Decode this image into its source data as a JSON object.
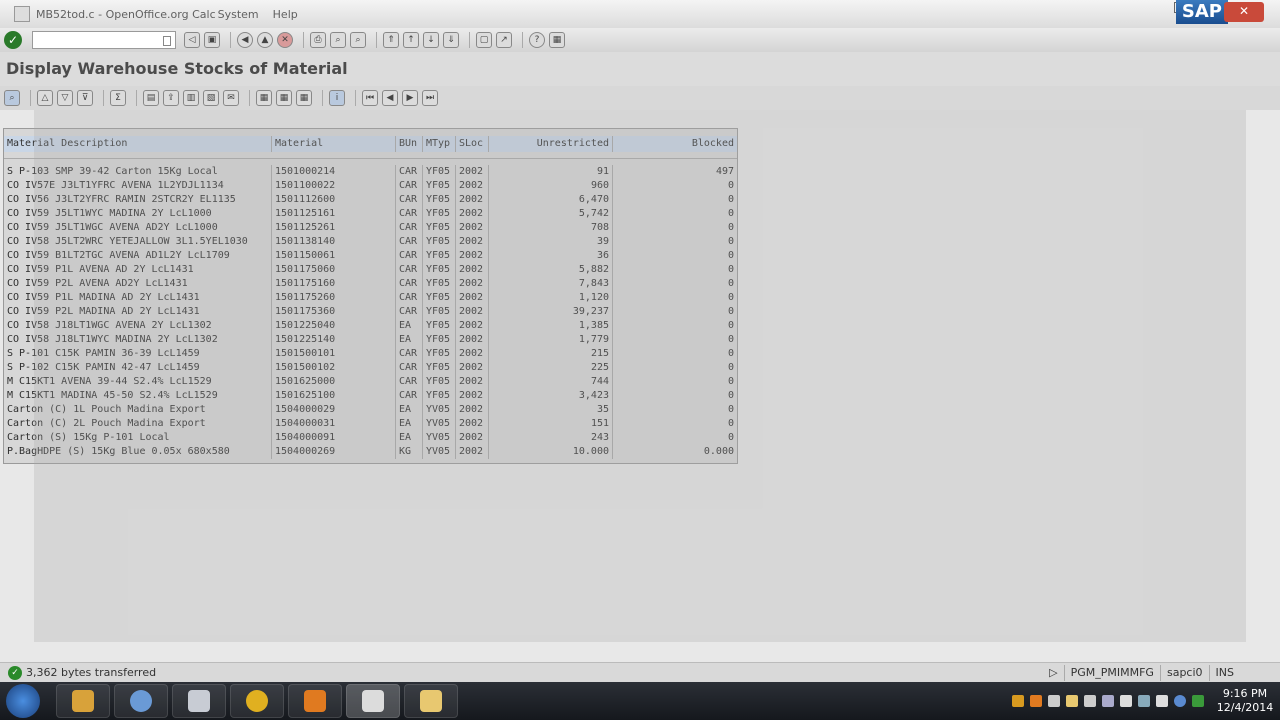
{
  "menubar": {
    "title_overlay": "MB52tod.c - OpenOffice.org Calc",
    "items": [
      "System",
      "Help"
    ]
  },
  "sap_logo": "SAP",
  "close_glyph": "✕",
  "screen": {
    "title": "Display Warehouse Stocks of Material"
  },
  "toolbar": {
    "command_placeholder": ""
  },
  "table": {
    "columns": [
      "Material Description",
      "Material",
      "BUn",
      "MTyp",
      "SLoc",
      "Unrestricted",
      "Blocked"
    ],
    "rows": [
      [
        "S P-103 SMP 39-42 Carton 15Kg Local",
        "1501000214",
        "CAR",
        "YF05",
        "2002",
        "91",
        "497"
      ],
      [
        "CO IV57E J3LT1YFRC AVENA 1L2YDJL1134",
        "1501100022",
        "CAR",
        "YF05",
        "2002",
        "960",
        "0"
      ],
      [
        "CO IV56 J3LT2YFRC RAMIN 2STCR2Y EL1135",
        "1501112600",
        "CAR",
        "YF05",
        "2002",
        "6,470",
        "0"
      ],
      [
        "CO IV59 J5LT1WYC MADINA 2Y LcL1000",
        "1501125161",
        "CAR",
        "YF05",
        "2002",
        "5,742",
        "0"
      ],
      [
        "CO IV59 J5LT1WGC AVENA AD2Y LcL1000",
        "1501125261",
        "CAR",
        "YF05",
        "2002",
        "708",
        "0"
      ],
      [
        "CO IV58 J5LT2WRC YETEJALLOW 3L1.5YEL1030",
        "1501138140",
        "CAR",
        "YF05",
        "2002",
        "39",
        "0"
      ],
      [
        "CO IV59 B1LT2TGC AVENA AD1L2Y LcL1709",
        "1501150061",
        "CAR",
        "YF05",
        "2002",
        "36",
        "0"
      ],
      [
        "CO IV59 P1L AVENA AD 2Y LcL1431",
        "1501175060",
        "CAR",
        "YF05",
        "2002",
        "5,882",
        "0"
      ],
      [
        "CO IV59 P2L AVENA AD2Y LcL1431",
        "1501175160",
        "CAR",
        "YF05",
        "2002",
        "7,843",
        "0"
      ],
      [
        "CO IV59 P1L MADINA AD 2Y LcL1431",
        "1501175260",
        "CAR",
        "YF05",
        "2002",
        "1,120",
        "0"
      ],
      [
        "CO IV59 P2L MADINA AD 2Y LcL1431",
        "1501175360",
        "CAR",
        "YF05",
        "2002",
        "39,237",
        "0"
      ],
      [
        "CO IV58 J18LT1WGC AVENA 2Y LcL1302",
        "1501225040",
        "EA",
        "YF05",
        "2002",
        "1,385",
        "0"
      ],
      [
        "CO IV58 J18LT1WYC MADINA 2Y LcL1302",
        "1501225140",
        "EA",
        "YF05",
        "2002",
        "1,779",
        "0"
      ],
      [
        "S P-101 C15K PAMIN 36-39 LcL1459",
        "1501500101",
        "CAR",
        "YF05",
        "2002",
        "215",
        "0"
      ],
      [
        "S P-102 C15K PAMIN 42-47 LcL1459",
        "1501500102",
        "CAR",
        "YF05",
        "2002",
        "225",
        "0"
      ],
      [
        "M C15KT1 AVENA 39-44 S2.4% LcL1529",
        "1501625000",
        "CAR",
        "YF05",
        "2002",
        "744",
        "0"
      ],
      [
        "M C15KT1 MADINA 45-50 S2.4% LcL1529",
        "1501625100",
        "CAR",
        "YF05",
        "2002",
        "3,423",
        "0"
      ],
      [
        "Carton (C) 1L Pouch Madina Export",
        "1504000029",
        "EA",
        "YV05",
        "2002",
        "35",
        "0"
      ],
      [
        "Carton (C) 2L Pouch Madina Export",
        "1504000031",
        "EA",
        "YV05",
        "2002",
        "151",
        "0"
      ],
      [
        "Carton (S) 15Kg P-101 Local",
        "1504000091",
        "EA",
        "YV05",
        "2002",
        "243",
        "0"
      ],
      [
        "P.BagHDPE (S) 15Kg Blue 0.05x 680x580",
        "1504000269",
        "KG",
        "YV05",
        "2002",
        "10.000",
        "0.000"
      ]
    ]
  },
  "status": {
    "message": "3,362 bytes transferred",
    "program": "PGM_PMIMMFG",
    "server": "sapci0",
    "mode": "INS"
  },
  "clock": {
    "time": "9:16 PM",
    "date": "12/4/2014"
  },
  "taskbar": {
    "apps": [
      "windows-explorer",
      "outlook",
      "calculator",
      "app-warning",
      "vlc",
      "openoffice-calc",
      "folder"
    ]
  }
}
